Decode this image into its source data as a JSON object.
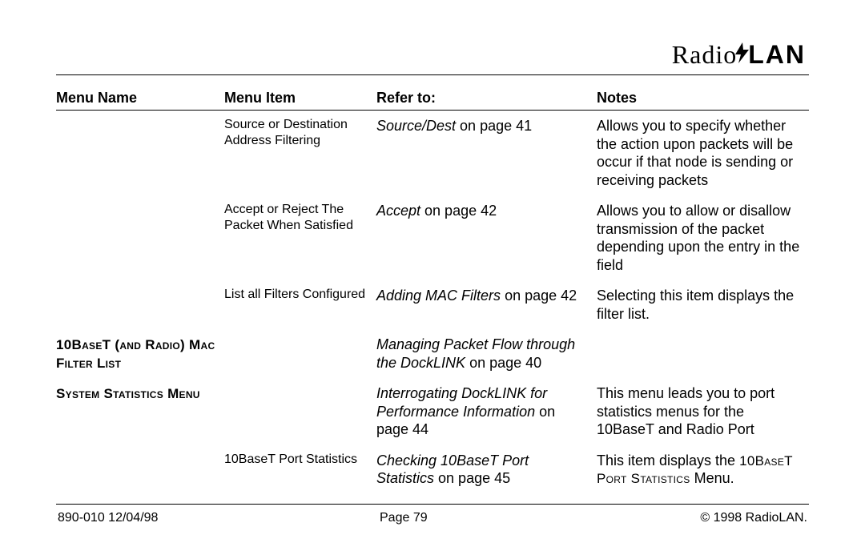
{
  "brand": {
    "part1": "Radio",
    "part2": "LAN"
  },
  "headers": {
    "c1": "Menu Name",
    "c2": "Menu Item",
    "c3": "Refer to:",
    "c4": "Notes"
  },
  "rows": [
    {
      "menu_name": "",
      "menu_item": "Source or Destination Address Filtering",
      "refer_italic": "Source/Dest",
      "refer_rest": " on page 41",
      "notes_pre": "",
      "notes_sc": "",
      "notes_post": "Allows you to specify whether the action upon packets will be occur if that node is sending or receiving packets"
    },
    {
      "menu_name": "",
      "menu_item": "Accept or Reject The Packet When Satisfied",
      "refer_italic": "Accept",
      "refer_rest": " on page 42",
      "notes_pre": "",
      "notes_sc": "",
      "notes_post": "Allows you to allow or disallow transmission of the packet depending upon the entry in the field"
    },
    {
      "menu_name": "",
      "menu_item": "List all Filters Configured",
      "refer_italic": "Adding MAC Filters",
      "refer_rest": " on page 42",
      "notes_pre": "",
      "notes_sc": "",
      "notes_post": "Selecting this item displays the filter list."
    },
    {
      "menu_name": "10BaseT (and Radio) Mac Filter List",
      "menu_item": "",
      "refer_italic": "Managing Packet Flow through the DockLINK",
      "refer_rest": " on page 40",
      "notes_pre": "",
      "notes_sc": "",
      "notes_post": ""
    },
    {
      "menu_name": "System Statistics Menu",
      "menu_item": "",
      "refer_italic": "Interrogating DockLINK for Performance Information",
      "refer_rest": " on page 44",
      "notes_pre": "",
      "notes_sc": "",
      "notes_post": "This menu leads you to port statistics menus for the 10BaseT and Radio Port"
    },
    {
      "menu_name": "",
      "menu_item": "10BaseT Port Statistics",
      "refer_italic": "Checking 10BaseT Port Statistics",
      "refer_rest": " on page 45",
      "notes_pre": "This item displays the ",
      "notes_sc": "10BaseT Port Statistics",
      "notes_post": " Menu."
    }
  ],
  "footer": {
    "left": "890-010  12/04/98",
    "mid": "Page 79",
    "right": "© 1998 RadioLAN."
  }
}
